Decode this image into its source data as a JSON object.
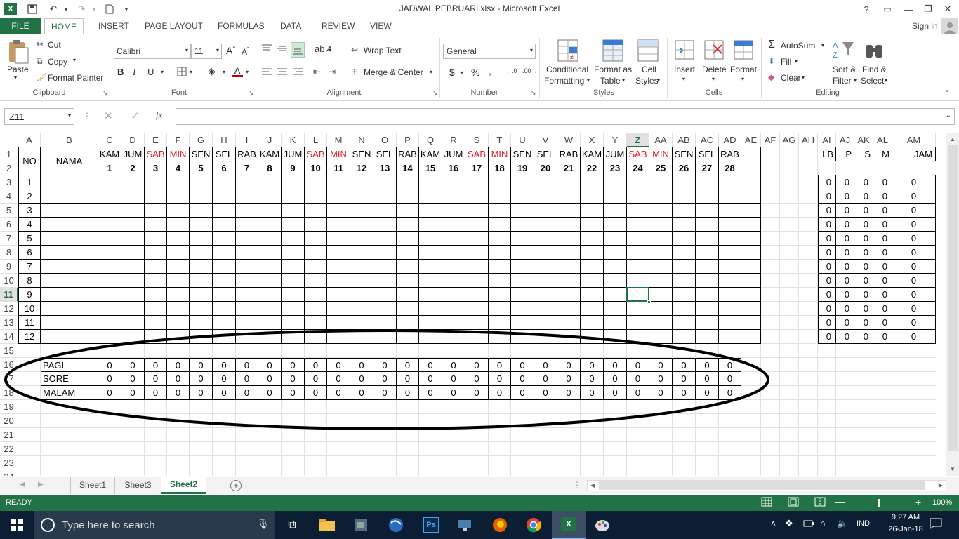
{
  "window": {
    "title": "JADWAL PEBRUARI.xlsx - Microsoft Excel",
    "help": "?",
    "minimize": "—",
    "restore": "❐",
    "close": "✕"
  },
  "ribbon_tabs": [
    "FILE",
    "HOME",
    "INSERT",
    "PAGE LAYOUT",
    "FORMULAS",
    "DATA",
    "REVIEW",
    "VIEW"
  ],
  "signin": "Sign in",
  "clipboard": {
    "paste": "Paste",
    "cut": "Cut",
    "copy": "Copy",
    "format_painter": "Format Painter",
    "label": "Clipboard"
  },
  "font": {
    "name": "Calibri",
    "size": "11",
    "label": "Font",
    "bold": "B",
    "italic": "I",
    "underline": "U"
  },
  "alignment": {
    "wrap": "Wrap Text",
    "merge": "Merge & Center",
    "label": "Alignment"
  },
  "number": {
    "format": "General",
    "currency": "$",
    "percent": "%",
    "comma": ",",
    "label": "Number"
  },
  "styles": {
    "conditional": "Conditional",
    "formatting": "Formatting",
    "format_as": "Format as",
    "table": "Table",
    "cell": "Cell",
    "cell_styles": "Styles",
    "label": "Styles"
  },
  "cells": {
    "insert": "Insert",
    "delete": "Delete",
    "format": "Format",
    "label": "Cells"
  },
  "editing": {
    "autosum": "AutoSum",
    "fill": "Fill",
    "clear": "Clear",
    "sort": "Sort &",
    "filter": "Filter",
    "find": "Find &",
    "select": "Select",
    "label": "Editing"
  },
  "formula_bar": {
    "name_box": "Z11",
    "fx": "fx",
    "value": ""
  },
  "columns": [
    "A",
    "B",
    "C",
    "D",
    "E",
    "F",
    "G",
    "H",
    "I",
    "J",
    "K",
    "L",
    "M",
    "N",
    "O",
    "P",
    "Q",
    "R",
    "S",
    "T",
    "U",
    "V",
    "W",
    "X",
    "Y",
    "Z",
    "AA",
    "AB",
    "AC",
    "AD",
    "AE",
    "AF",
    "AG",
    "AH",
    "AI",
    "AJ",
    "AK",
    "AL",
    "AM"
  ],
  "rows": [
    "1",
    "2",
    "3",
    "4",
    "5",
    "6",
    "7",
    "8",
    "9",
    "10",
    "11",
    "12",
    "13",
    "14",
    "15",
    "16",
    "17",
    "18",
    "19",
    "20",
    "21",
    "22",
    "23",
    "24"
  ],
  "header": {
    "no": "NO",
    "nama": "NAMA",
    "lb": "LB",
    "p": "P",
    "s": "S",
    "m": "M",
    "jam": "JAM"
  },
  "days": [
    "KAM",
    "JUM",
    "SAB",
    "MIN",
    "SEN",
    "SEL",
    "RAB",
    "KAM",
    "JUM",
    "SAB",
    "MIN",
    "SEN",
    "SEL",
    "RAB",
    "KAM",
    "JUM",
    "SAB",
    "MIN",
    "SEN",
    "SEL",
    "RAB",
    "KAM",
    "JUM",
    "SAB",
    "MIN",
    "SEN",
    "SEL",
    "RAB"
  ],
  "dates": [
    "1",
    "2",
    "3",
    "4",
    "5",
    "6",
    "7",
    "8",
    "9",
    "10",
    "11",
    "12",
    "13",
    "14",
    "15",
    "16",
    "17",
    "18",
    "19",
    "20",
    "21",
    "22",
    "23",
    "24",
    "25",
    "26",
    "27",
    "28"
  ],
  "numbers": [
    "1",
    "2",
    "3",
    "4",
    "5",
    "6",
    "7",
    "8",
    "9",
    "10",
    "11",
    "12"
  ],
  "zero": "0",
  "shifts": [
    "PAGI",
    "SORE",
    "MALAM"
  ],
  "sheets": [
    "Sheet1",
    "Sheet3",
    "Sheet2"
  ],
  "status": {
    "ready": "READY",
    "zoom": "100%"
  },
  "taskbar": {
    "search": "Type here to search",
    "lang": "IND",
    "time": "9:27 AM",
    "date": "26-Jan-18"
  },
  "colors": {
    "excel_green": "#217346",
    "red": "#e21f26"
  }
}
